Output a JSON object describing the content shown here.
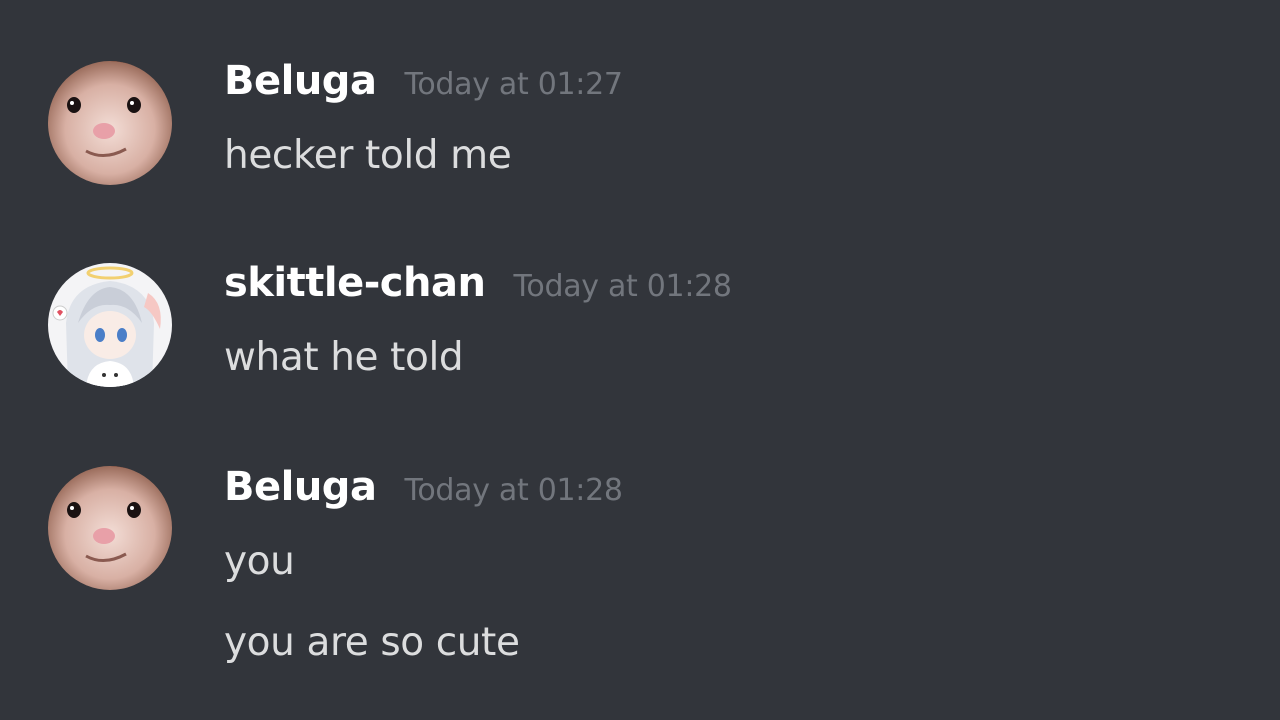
{
  "colors": {
    "background": "#32353b",
    "username": "#ffffff",
    "timestamp": "#72767d",
    "message_text": "#dcddde"
  },
  "messages": [
    {
      "author": "Beluga",
      "avatar_icon": "cat-face-avatar-icon",
      "timestamp": "Today at 01:27",
      "lines": [
        "hecker told me"
      ]
    },
    {
      "author": "skittle-chan",
      "avatar_icon": "anime-girl-halo-avatar-icon",
      "timestamp": "Today at 01:28",
      "lines": [
        "what he told"
      ]
    },
    {
      "author": "Beluga",
      "avatar_icon": "cat-face-avatar-icon",
      "timestamp": "Today at 01:28",
      "lines": [
        "you",
        "you are so cute"
      ]
    }
  ]
}
